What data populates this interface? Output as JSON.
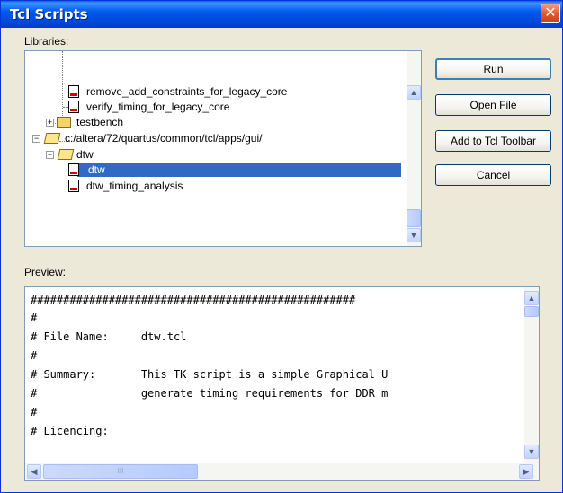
{
  "window": {
    "title": "Tcl Scripts",
    "close_glyph": "✕"
  },
  "libraries_label": "Libraries:",
  "preview_label": "Preview:",
  "tree": {
    "items": [
      {
        "label": "remove_add_constraints_for_legacy_core",
        "icon": "tcl-file-icon"
      },
      {
        "label": "verify_timing_for_legacy_core",
        "icon": "tcl-file-icon"
      },
      {
        "label": "testbench",
        "icon": "folder-icon"
      },
      {
        "label": "c:/altera/72/quartus/common/tcl/apps/gui/",
        "icon": "open-folder-icon"
      },
      {
        "label": "dtw",
        "icon": "open-folder-icon"
      },
      {
        "label": "dtw",
        "icon": "tcl-file-icon",
        "selected": true
      },
      {
        "label": "dtw_timing_analysis",
        "icon": "tcl-file-icon"
      }
    ]
  },
  "buttons": {
    "run": "Run",
    "open_file": "Open File",
    "add_to_toolbar": "Add to Tcl Toolbar",
    "cancel": "Cancel"
  },
  "preview": {
    "lines": [
      "##################################################",
      "#",
      "# File Name:     dtw.tcl",
      "#",
      "# Summary:       This TK script is a simple Graphical U",
      "#                generate timing requirements for DDR m",
      "#",
      "# Licencing:"
    ]
  },
  "scroll": {
    "up": "▲",
    "down": "▼",
    "left": "◀",
    "right": "▶",
    "grip": "III"
  },
  "tree_expander": {
    "plus": "+",
    "minus": "−"
  },
  "colors": {
    "selection": "#316ac5",
    "title_bar": "#0058ee",
    "dialog_bg": "#ece9d8"
  }
}
